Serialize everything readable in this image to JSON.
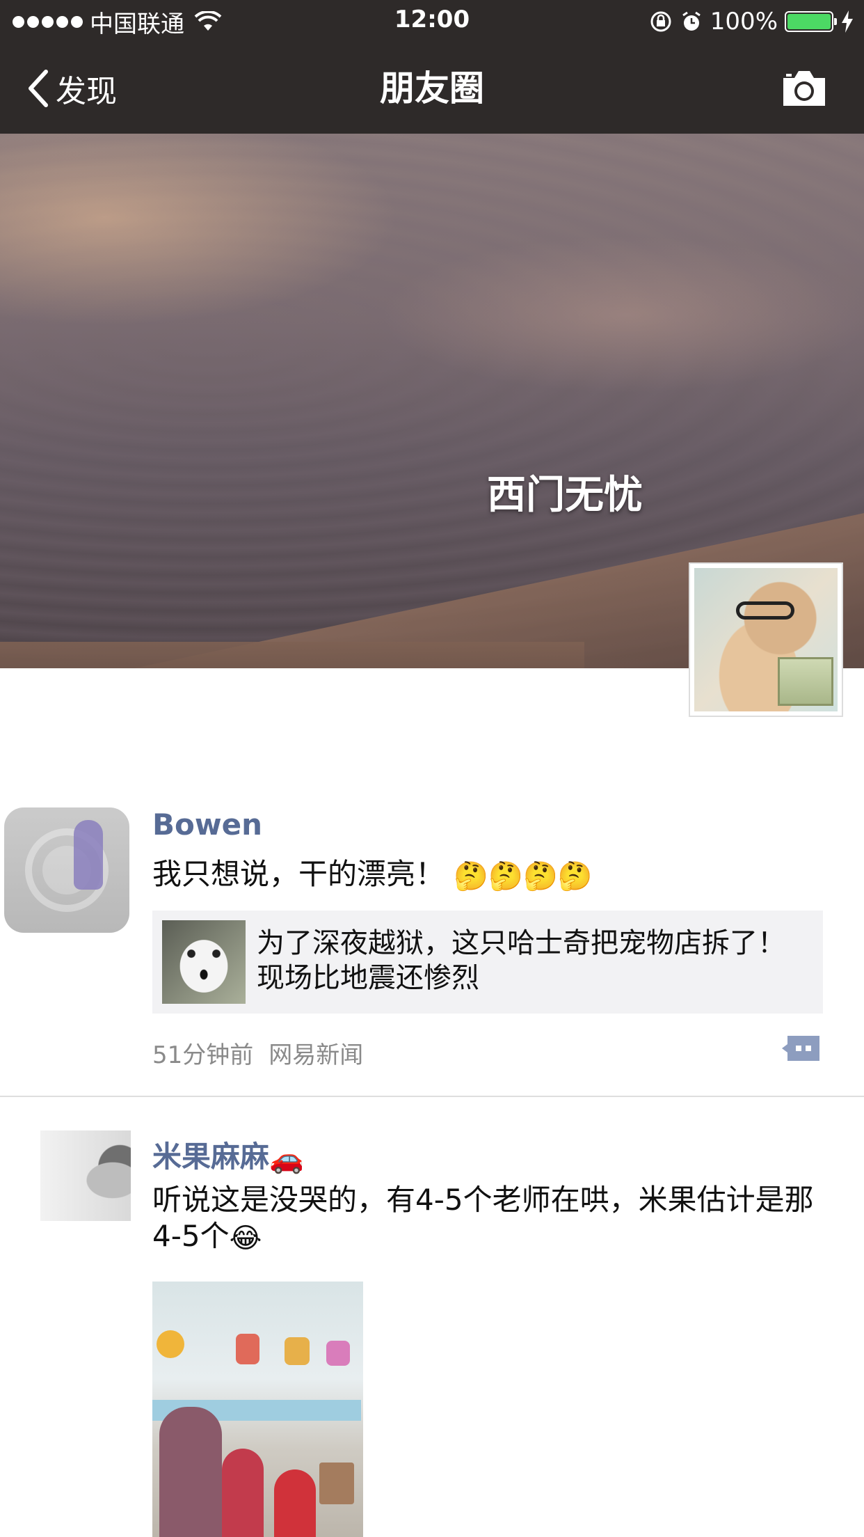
{
  "status_bar": {
    "carrier": "中国联通",
    "time": "12:00",
    "battery": "100%",
    "battery_level": 1.0
  },
  "nav": {
    "back_label": "发现",
    "title": "朋友圈",
    "camera_icon": "camera-icon"
  },
  "cover": {
    "owner_name": "西门无忧"
  },
  "posts": [
    {
      "user": "Bowen",
      "text": "我只想说，干的漂亮！",
      "emojis": [
        "🤔",
        "🤔",
        "🤔",
        "🤔"
      ],
      "share_title": "为了深夜越狱，这只哈士奇把宠物店拆了！现场比地震还惨烈",
      "time": "51分钟前",
      "source": "网易新闻"
    },
    {
      "user": "米果麻麻",
      "user_emoji": "🚗",
      "text": "听说这是没哭的，有4-5个老师在哄，米果估计是那4-5个",
      "text_emoji": "😂"
    }
  ],
  "colors": {
    "bar_bg": "#2e2a29",
    "link_blue": "#576b95",
    "battery_green": "#4cd964"
  }
}
